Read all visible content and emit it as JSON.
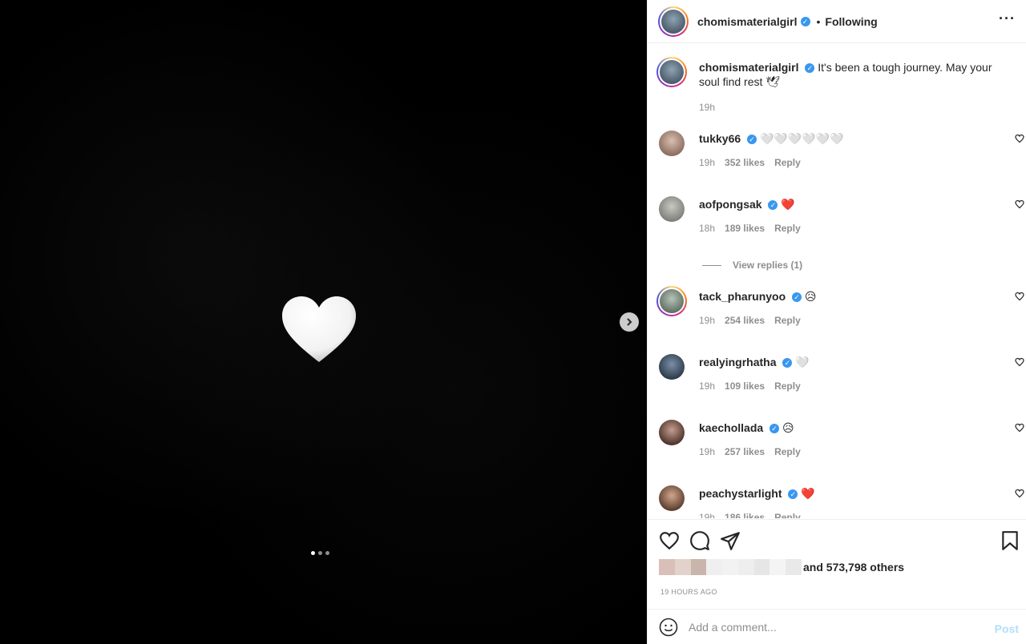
{
  "post": {
    "author": "chomismaterialgirl",
    "follow_status": "Following",
    "separator": "•",
    "more_label": "···",
    "caption_text": "It's been a tough journey. May your soul find rest 🕊",
    "caption_time": "19h",
    "carousel_dots": 3,
    "active_dot": 0
  },
  "comments": [
    {
      "user": "tukky66",
      "text": "🤍🤍🤍🤍🤍🤍",
      "time": "19h",
      "likes": "352 likes",
      "reply": "Reply",
      "avatar_color": "#b99a8b"
    },
    {
      "user": "aofpongsak",
      "text": "❤️",
      "time": "18h",
      "likes": "189 likes",
      "reply": "Reply",
      "avatar_color": "#9a9a96"
    },
    {
      "user": "tack_pharunyoo",
      "text": "😥",
      "time": "19h",
      "likes": "254 likes",
      "reply": "Reply",
      "avatar_color": "#6c7a6e"
    },
    {
      "user": "realyingrhatha",
      "text": "🤍",
      "time": "19h",
      "likes": "109 likes",
      "reply": "Reply",
      "avatar_color": "#3a4a5c"
    },
    {
      "user": "kaechollada",
      "text": "😥",
      "time": "19h",
      "likes": "257 likes",
      "reply": "Reply",
      "avatar_color": "#5a3f38"
    },
    {
      "user": "peachystarlight",
      "text": "❤️",
      "time": "19h",
      "likes": "186 likes",
      "reply": "Reply",
      "avatar_color": "#6e4c3c"
    }
  ],
  "view_replies": "View replies (1)",
  "likes": {
    "text": "and 573,798 others",
    "time_ago": "19 HOURS AGO"
  },
  "composer": {
    "placeholder": "Add a comment...",
    "post_label": "Post"
  },
  "colors": {
    "verified": "#3897f0",
    "heart_red": "#ed1c24",
    "post_button_disabled": "#b2dffc"
  }
}
